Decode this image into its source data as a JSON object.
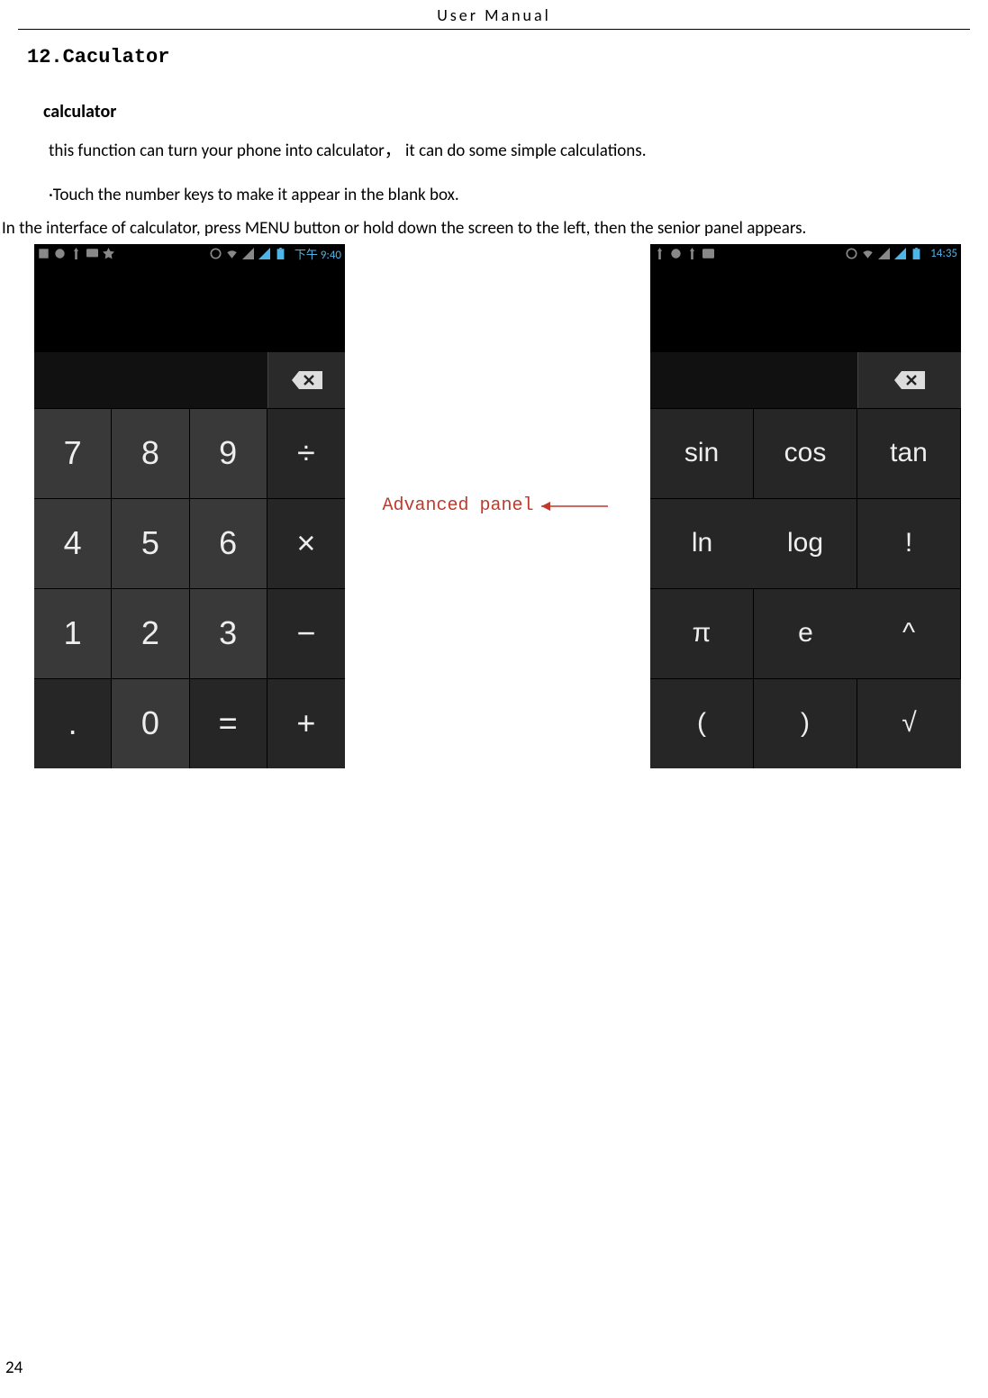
{
  "header": {
    "title": "User  Manual"
  },
  "section": {
    "heading": "12.Caculator"
  },
  "content": {
    "subheading": "calculator",
    "paragraph": "this function can turn your phone into calculator，  it can do some simple calculations.",
    "bullet": "·Touch the number keys to make it appear in the blank box.",
    "paragraph2": "In the interface of calculator, press MENU button or hold down the screen to the left, then the senior panel appears."
  },
  "annotation": {
    "advanced_panel": "Advanced panel"
  },
  "phone1": {
    "status_time": "下午 9:40",
    "keys": [
      "7",
      "8",
      "9",
      "÷",
      "4",
      "5",
      "6",
      "×",
      "1",
      "2",
      "3",
      "−",
      ".",
      "0",
      "=",
      "+"
    ]
  },
  "phone2": {
    "status_time": "14:35",
    "keys": [
      "sin",
      "cos",
      "tan",
      "ln",
      "log",
      "!",
      "π",
      "e",
      "^",
      "(",
      ")",
      "√"
    ]
  },
  "page_number": "24"
}
